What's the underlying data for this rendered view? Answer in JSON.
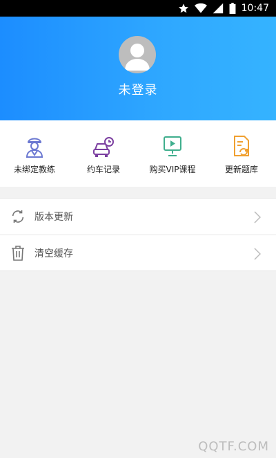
{
  "status_bar": {
    "time": "10:47",
    "icons": [
      "star-icon",
      "wifi-icon",
      "signal-icon",
      "battery-icon"
    ]
  },
  "header": {
    "username": "未登录",
    "gradient_start": "#1c8dff",
    "gradient_end": "#35b3ff"
  },
  "quick_actions": [
    {
      "label": "未绑定教练",
      "icon": "coach-icon",
      "color": "#6b78d1"
    },
    {
      "label": "约车记录",
      "icon": "car-clock-icon",
      "color": "#7b3fa0"
    },
    {
      "label": "购买VIP课程",
      "icon": "video-course-icon",
      "color": "#3fae8d"
    },
    {
      "label": "更新题库",
      "icon": "document-refresh-icon",
      "color": "#f0a030"
    }
  ],
  "settings": [
    {
      "label": "版本更新",
      "icon": "refresh-icon"
    },
    {
      "label": "清空缓存",
      "icon": "trash-icon"
    }
  ],
  "watermark": "QQTF.COM"
}
